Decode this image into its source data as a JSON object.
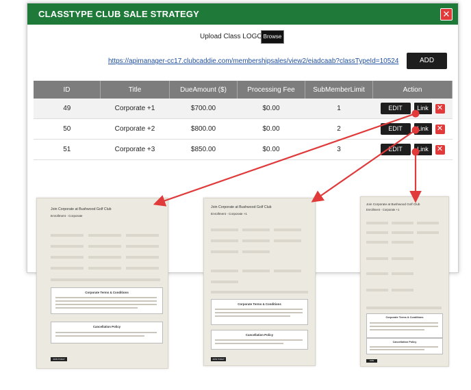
{
  "modal": {
    "title": "CLASSTYPE CLUB SALE STRATEGY",
    "close_label": "✕",
    "upload_label": "Upload Class LOGO",
    "browse_label": "Browse",
    "url": "https://apimanager-cc17.clubcaddie.com/membershipsales/view2/eiadcaab?classTypeId=10524",
    "add_label": "ADD",
    "header_color": "#1f7a3a"
  },
  "table": {
    "columns": [
      "ID",
      "Title",
      "DueAmount ($)",
      "Processing Fee",
      "SubMemberLimit",
      "Action"
    ],
    "rows": [
      {
        "id": "49",
        "title": "Corporate +1",
        "due": "$700.00",
        "fee": "$0.00",
        "limit": "1"
      },
      {
        "id": "50",
        "title": "Corporate +2",
        "due": "$800.00",
        "fee": "$0.00",
        "limit": "2"
      },
      {
        "id": "51",
        "title": "Corporate +3",
        "due": "$850.00",
        "fee": "$0.00",
        "limit": "3"
      }
    ],
    "edit_label": "EDIT",
    "link_label": "Link",
    "delete_label": "✕"
  },
  "previews": [
    {
      "heading": "Join Corporate at Bushwood Golf Club",
      "subheading": "Enrollment - Corporate",
      "terms_title": "Corporate Terms & Conditions",
      "cancel_title": "Cancellation Policy",
      "join_label": "JOIN TODAY"
    },
    {
      "heading": "Join Corporate at Bushwood Golf Club",
      "subheading": "Enrollment - Corporate +1",
      "terms_title": "Corporate Terms & Conditions",
      "cancel_title": "Cancellation Policy",
      "join_label": "JOIN TODAY"
    },
    {
      "heading": "Join Corporate at Bushwood Golf Club",
      "subheading": "Enrollment - Corporate +1",
      "terms_title": "Corporate Terms & Conditions",
      "cancel_title": "Cancellation Policy",
      "join_label": "JOIN"
    }
  ],
  "colors": {
    "accent_red": "#e03a3a",
    "header_gray": "#7d7d7d"
  }
}
